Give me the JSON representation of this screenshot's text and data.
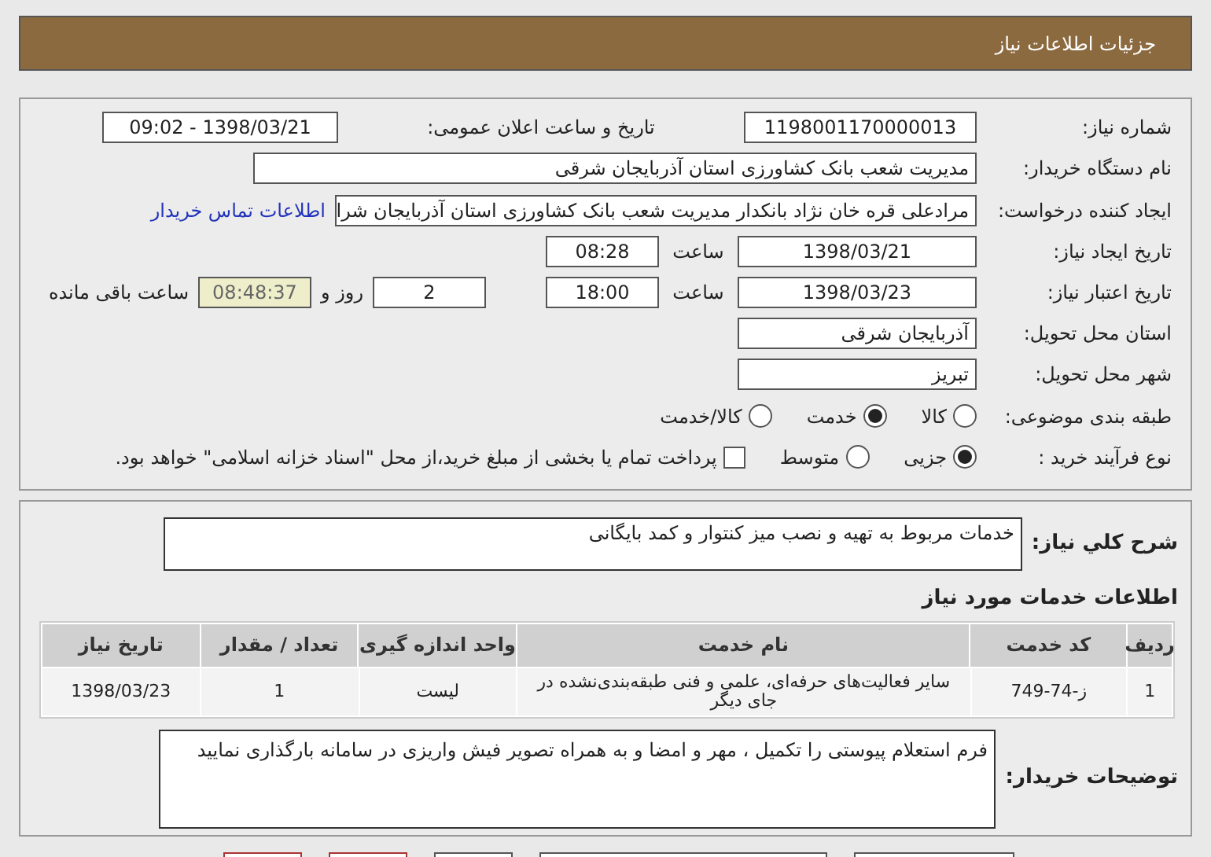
{
  "header": {
    "title": "جزئیات اطلاعات نیاز"
  },
  "details": {
    "need_number": {
      "label": "شماره نیاز:",
      "value": "1198001170000013"
    },
    "announce": {
      "label": "تاریخ و ساعت اعلان عمومی:",
      "value": "1398/03/21 - 09:02"
    },
    "buyer_org": {
      "label": "نام دستگاه خریدار:",
      "value": "مدیریت شعب بانک کشاورزی استان آذربایجان شرقی"
    },
    "requester": {
      "label": "ایجاد کننده درخواست:",
      "value": "مرادعلی قره خان نژاد بانکدار مدیریت شعب بانک کشاورزی استان آذربایجان شرا",
      "link": "اطلاعات تماس خریدار"
    },
    "created": {
      "label": "تاریخ ایجاد نیاز:",
      "date": "1398/03/21",
      "time_label": "ساعت",
      "time": "08:28"
    },
    "valid": {
      "label": "تاریخ اعتبار نیاز:",
      "date": "1398/03/23",
      "time_label": "ساعت",
      "time": "18:00",
      "days": "2",
      "days_label": "روز و",
      "remaining": "08:48:37",
      "remaining_label": "ساعت باقی مانده"
    },
    "province": {
      "label": "استان محل تحویل:",
      "value": "آذربایجان شرقی"
    },
    "city": {
      "label": "شهر محل تحویل:",
      "value": "تبریز"
    },
    "category": {
      "label": "طبقه بندی موضوعی:",
      "options": [
        {
          "label": "کالا",
          "selected": false
        },
        {
          "label": "خدمت",
          "selected": true
        },
        {
          "label": "کالا/خدمت",
          "selected": false
        }
      ]
    },
    "process": {
      "label": "نوع فرآیند خرید :",
      "options": [
        {
          "label": "جزیی",
          "selected": true
        },
        {
          "label": "متوسط",
          "selected": false
        }
      ],
      "treasury": {
        "label": "پرداخت تمام یا بخشی از مبلغ خرید،از محل \"اسناد خزانه اسلامی\" خواهد بود.",
        "checked": false
      }
    }
  },
  "summary": {
    "label": "شرح کلي نياز:",
    "value": "خدمات مربوط به تهیه و نصب میز کنتوار و کمد بایگانی"
  },
  "services": {
    "title": "اطلاعات خدمات مورد نیاز",
    "columns": [
      "ردیف",
      "کد خدمت",
      "نام خدمت",
      "واحد اندازه گیری",
      "تعداد / مقدار",
      "تاریخ نیاز"
    ],
    "rows": [
      [
        "1",
        "ز-74-749",
        "سایر فعالیت‌های حرفه‌ای، علمی و فنی طبقه‌بندی‌نشده در جای دیگر",
        "لیست",
        "1",
        "1398/03/23"
      ]
    ]
  },
  "buyer_notes": {
    "label": "توضیحات خریدار:",
    "value": "فرم استعلام پیوستی را تکمیل ، مهر و امضا و به همراه تصویر فیش واریزی در سامانه بارگذاری نمایید"
  },
  "bottom_buttons": [
    {
      "color": "#555555"
    },
    {
      "color": "#555555"
    },
    {
      "color": "#555555"
    },
    {
      "color": "#aa3333"
    },
    {
      "color": "#aa3333"
    }
  ]
}
